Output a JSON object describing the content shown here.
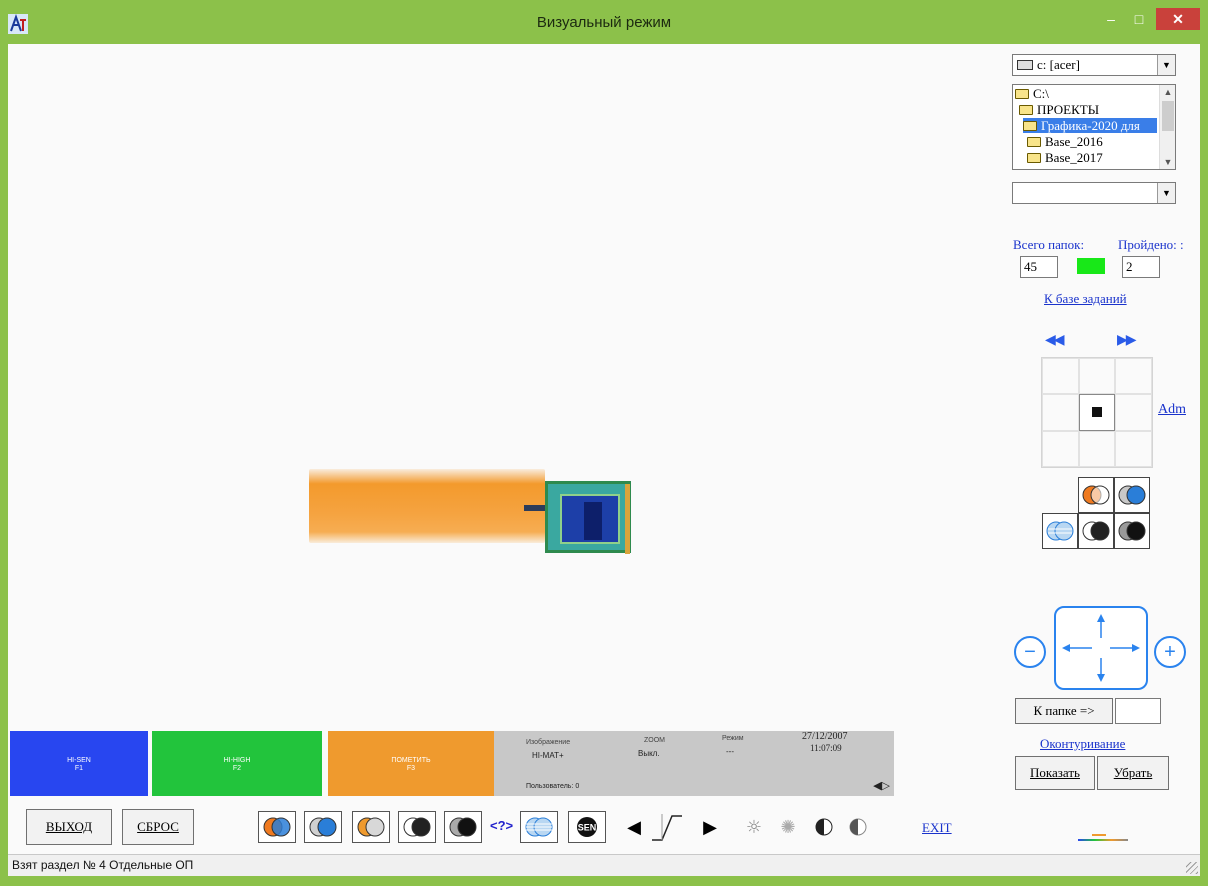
{
  "window": {
    "title": "Визуальный режим",
    "minimize": "–",
    "maximize": "□",
    "close": "✕"
  },
  "explorer": {
    "drive": "c: [acer]",
    "folders": [
      {
        "label": "C:\\",
        "selected": false
      },
      {
        "label": "ПРОЕКТЫ",
        "selected": false
      },
      {
        "label": "Графика-2020 для",
        "selected": true
      },
      {
        "label": "Base_2016",
        "selected": false
      },
      {
        "label": "Base_2017",
        "selected": false
      }
    ],
    "file": ""
  },
  "counters": {
    "total_label": "Всего папок:",
    "total_value": "45",
    "passed_label": "Пройдено: :",
    "passed_value": "2",
    "indicator_color": "#18e818"
  },
  "links": {
    "task_base": "К базе заданий",
    "adm": "Adm",
    "contouring": "Оконтуривание",
    "exit": "EXIT"
  },
  "folder_nav": {
    "prev": "◀◀",
    "next": "▶▶"
  },
  "zoom": {
    "minus": "−",
    "plus": "+"
  },
  "goto_folder": {
    "label": "К папке =>",
    "value": ""
  },
  "contour_buttons": {
    "show": "Показать",
    "hide": "Убрать"
  },
  "bottom_buttons": {
    "exit_label": "ВЫХОД",
    "reset_label": "СБРОС",
    "help": "<?>",
    "sen_label": "SEN"
  },
  "status_boxes": [
    {
      "label": "HI-SEN",
      "key": "F1",
      "color": "#2846f0"
    },
    {
      "label": "HI-HIGH",
      "key": "F2",
      "color": "#22c43c"
    },
    {
      "label": "ПОМЕТИТЬ",
      "key": "F3",
      "color": "#ef9a2e"
    }
  ],
  "info_panel": {
    "image_label": "Изображение",
    "image_value": "HI-MAT+",
    "zoom_label": "ZOOM",
    "zoom_value": "Выкл.",
    "mode_label": "Режим",
    "mode_value": "---",
    "date": "27/12/2007",
    "time": "11:07:09",
    "user_label": "Пользователь: 0"
  },
  "statusbar": {
    "text": "Взят раздел № 4 Отдельные ОП"
  },
  "colors": {
    "accent": "#2a83ee",
    "link": "#1a33cc",
    "window_frame": "#8cc14a",
    "orange": "#ef9a2e"
  }
}
